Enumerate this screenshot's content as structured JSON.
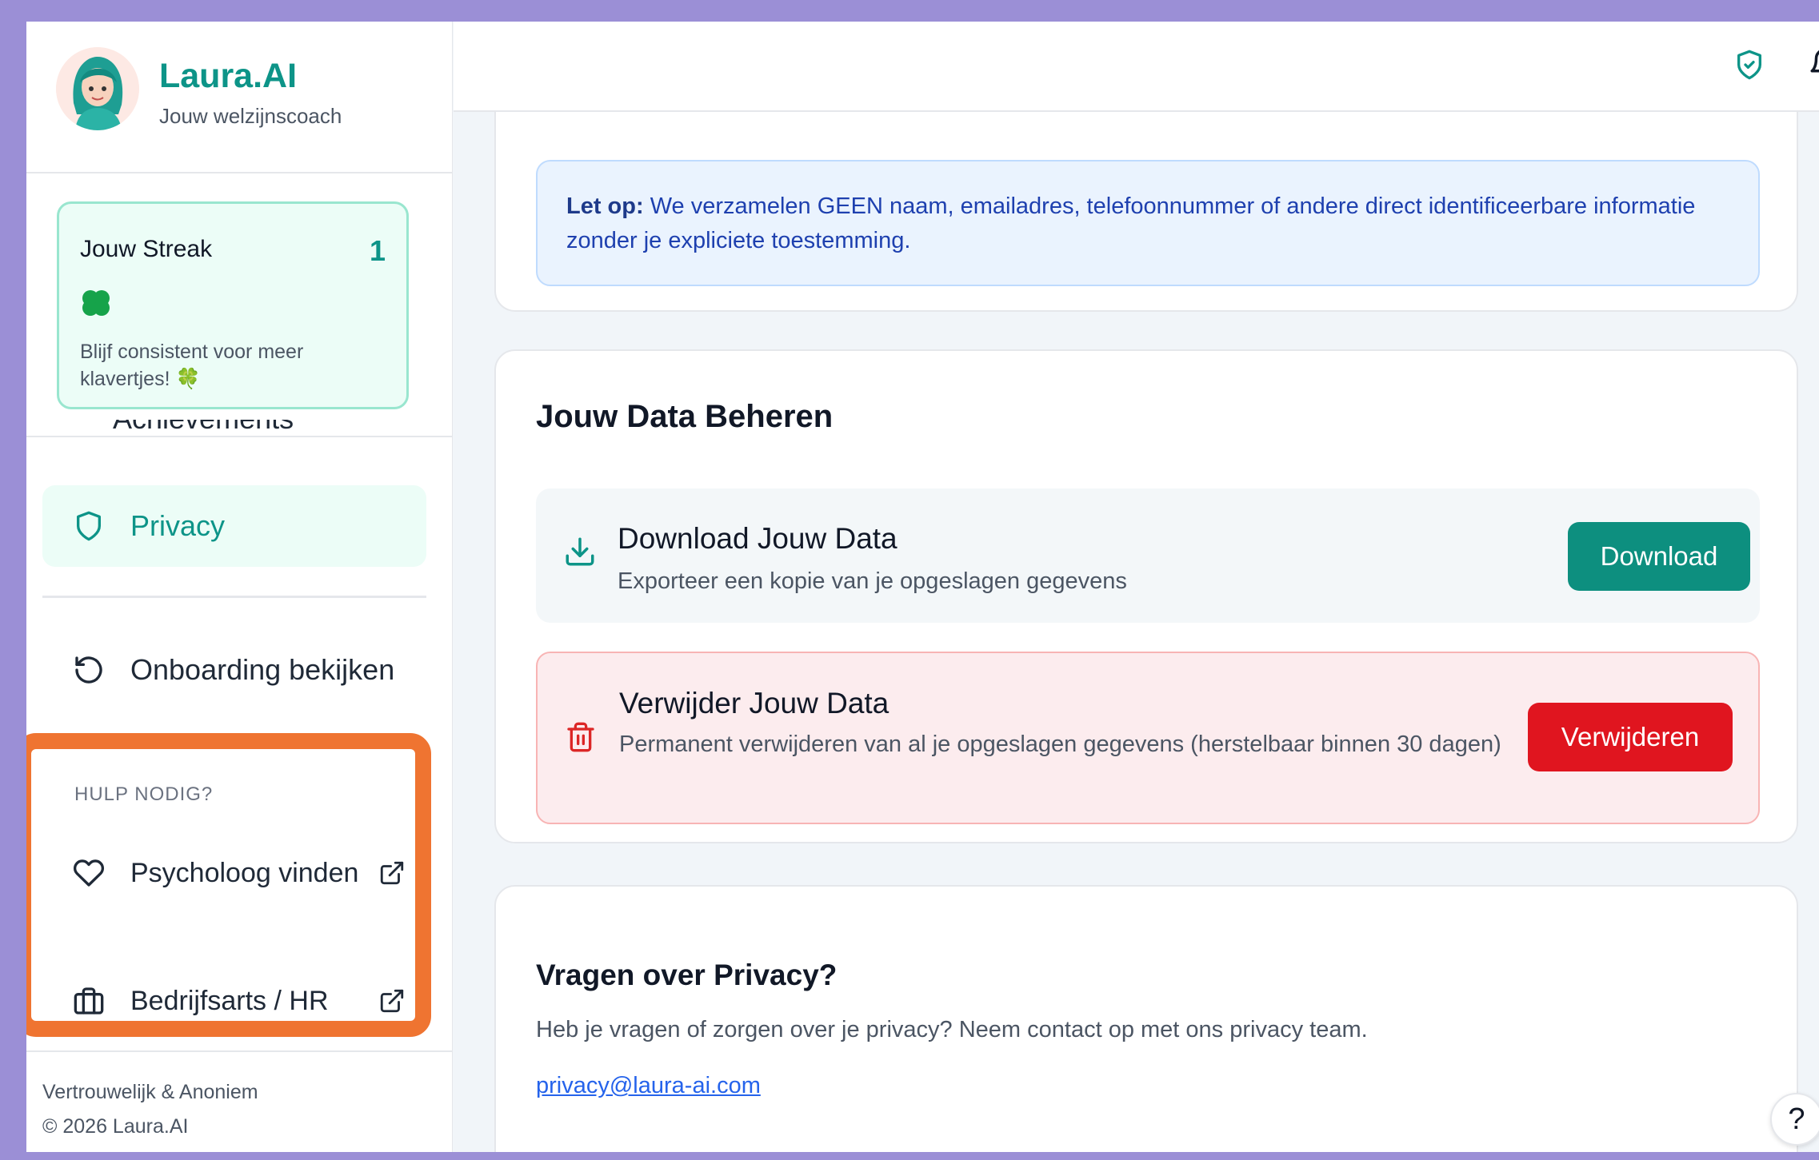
{
  "brand": {
    "title": "Laura.AI",
    "subtitle": "Jouw welzijnscoach"
  },
  "streak": {
    "title": "Jouw Streak",
    "count": "1",
    "text": "Blijf consistent voor meer klavertjes! 🍀"
  },
  "sidebar": {
    "partial_item": "Achievements",
    "items": [
      {
        "label": "Privacy",
        "icon": "shield-icon",
        "active": true
      },
      {
        "label": "Onboarding bekijken",
        "icon": "rotate-ccw-icon",
        "active": false
      }
    ],
    "help": {
      "title": "HULP NODIG?",
      "items": [
        {
          "label": "Psycholoog vinden",
          "icon": "heart-icon"
        },
        {
          "label": "Bedrijfsarts / HR",
          "icon": "briefcase-icon"
        }
      ]
    },
    "footer": {
      "line1": "Vertrouwelijk & Anoniem",
      "line2": "© 2026 Laura.AI"
    }
  },
  "header": {
    "icons": [
      "shield-check-icon",
      "bell-icon"
    ]
  },
  "notice": {
    "label": "Let op:",
    "text": " We verzamelen GEEN naam, emailadres, telefoonnummer of andere direct identificeerbare informatie zonder je expliciete toestemming."
  },
  "manage": {
    "title": "Jouw Data Beheren",
    "download": {
      "title": "Download Jouw Data",
      "desc": "Exporteer een kopie van je opgeslagen gegevens",
      "button": "Download"
    },
    "delete": {
      "title": "Verwijder Jouw Data",
      "desc": "Permanent verwijderen van al je opgeslagen gegevens (herstelbaar binnen 30 dagen)",
      "button": "Verwijderen"
    }
  },
  "questions": {
    "title": "Vragen over Privacy?",
    "text": "Heb je vragen of zorgen over je privacy? Neem contact op met ons privacy team.",
    "email": "privacy@laura-ai.com"
  },
  "help_fab": "?",
  "colors": {
    "accent": "#0d9488",
    "danger": "#e0151f",
    "highlight_border": "#ef7431",
    "frame": "#9b8fd6"
  }
}
